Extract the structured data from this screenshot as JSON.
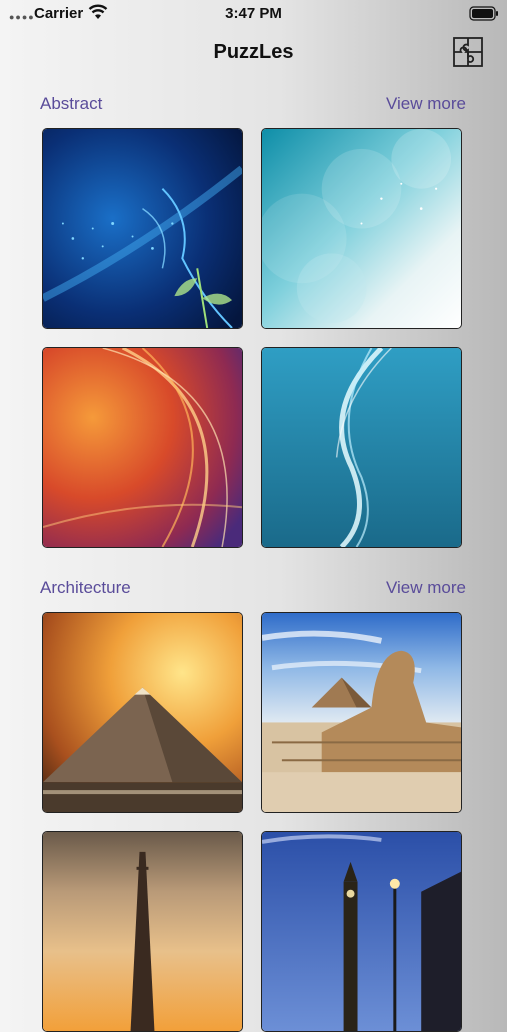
{
  "status": {
    "carrier": "Carrier",
    "time": "3:47 PM"
  },
  "nav": {
    "title": "PuzzLes",
    "icon": "puzzle-icon"
  },
  "sections": [
    {
      "title": "Abstract",
      "view_more": "View more",
      "tiles": [
        "abstract-blue-plant",
        "abstract-teal-bokeh",
        "abstract-orange-waves",
        "abstract-teal-ribbon"
      ]
    },
    {
      "title": "Architecture",
      "view_more": "View more",
      "tiles": [
        "pyramid-sunset",
        "sphinx-pyramid",
        "eiffel-tower",
        "big-ben"
      ]
    }
  ],
  "colors": {
    "accent": "#5a4c9a",
    "title": "#111111"
  }
}
